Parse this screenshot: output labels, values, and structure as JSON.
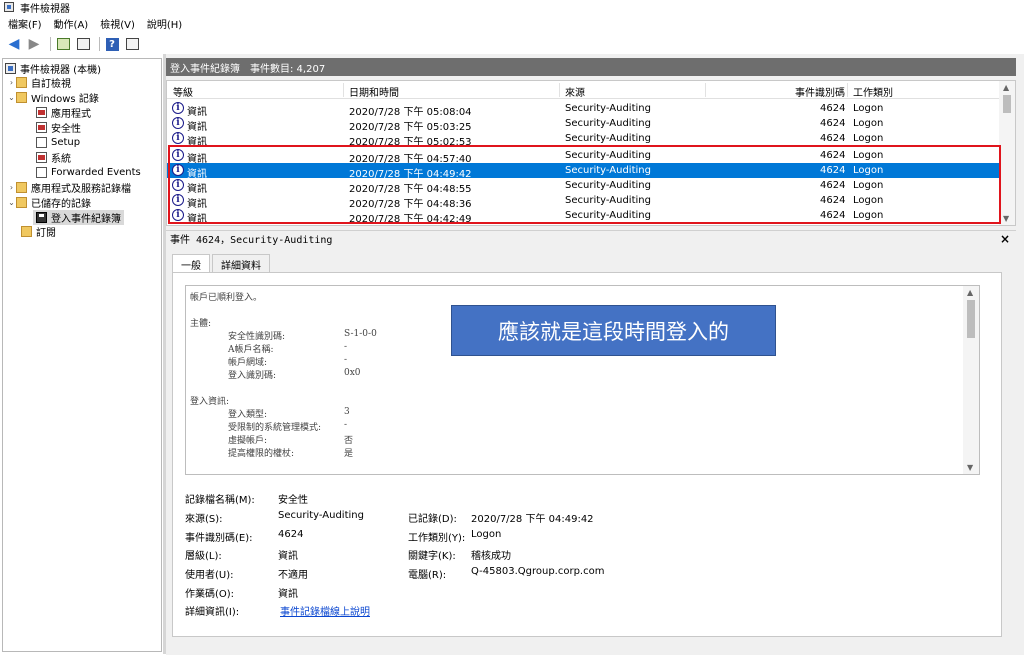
{
  "window": {
    "title": "事件檢視器"
  },
  "menu": [
    "檔案(F)",
    "動作(A)",
    "檢視(V)",
    "說明(H)"
  ],
  "tree": [
    {
      "label": "事件檢視器 (本機)",
      "icon": "root-icon"
    },
    {
      "label": "自訂檢視",
      "icon": "folder-icon"
    },
    {
      "label": "Windows 記錄",
      "icon": "folder-icon"
    },
    {
      "label": "應用程式",
      "icon": "log-icon"
    },
    {
      "label": "安全性",
      "icon": "log-icon"
    },
    {
      "label": "Setup",
      "icon": "log-icon"
    },
    {
      "label": "系統",
      "icon": "log-icon"
    },
    {
      "label": "Forwarded Events",
      "icon": "log-icon"
    },
    {
      "label": "應用程式及服務記錄檔",
      "icon": "folder-icon"
    },
    {
      "label": "已儲存的記錄",
      "icon": "folder-icon"
    },
    {
      "label": "登入事件紀錄簿",
      "icon": "saved-log-icon"
    },
    {
      "label": "訂閱",
      "icon": "subscription-icon"
    }
  ],
  "log_header": {
    "name": "登入事件紀錄簿",
    "count": "事件數目: 4,207"
  },
  "grid": {
    "columns": [
      "等級",
      "日期和時間",
      "來源",
      "事件識別碼",
      "工作類別"
    ],
    "rows": [
      {
        "level": "資訊",
        "datetime": "2020/7/28 下午 05:08:04",
        "source": "Security-Auditing",
        "id": "4624",
        "category": "Logon"
      },
      {
        "level": "資訊",
        "datetime": "2020/7/28 下午 05:03:25",
        "source": "Security-Auditing",
        "id": "4624",
        "category": "Logon"
      },
      {
        "level": "資訊",
        "datetime": "2020/7/28 下午 05:02:53",
        "source": "Security-Auditing",
        "id": "4624",
        "category": "Logon"
      },
      {
        "level": "資訊",
        "datetime": "2020/7/28 下午 04:57:40",
        "source": "Security-Auditing",
        "id": "4624",
        "category": "Logon"
      },
      {
        "level": "資訊",
        "datetime": "2020/7/28 下午 04:49:42",
        "source": "Security-Auditing",
        "id": "4624",
        "category": "Logon"
      },
      {
        "level": "資訊",
        "datetime": "2020/7/28 下午 04:48:55",
        "source": "Security-Auditing",
        "id": "4624",
        "category": "Logon"
      },
      {
        "level": "資訊",
        "datetime": "2020/7/28 下午 04:48:36",
        "source": "Security-Auditing",
        "id": "4624",
        "category": "Logon"
      },
      {
        "level": "資訊",
        "datetime": "2020/7/28 下午 04:42:49",
        "source": "Security-Auditing",
        "id": "4624",
        "category": "Logon"
      }
    ]
  },
  "detail": {
    "title": "事件 4624，Security-Auditing",
    "close": "×",
    "tabs": [
      "一般",
      "詳細資料"
    ],
    "description": [
      "帳戶已順利登入。",
      "主體:",
      "安全性識別碼:",
      "S-1-0-0",
      "A帳戶名稱:",
      "-",
      "帳戶網域:",
      "-",
      "登入識別碼:",
      "0x0",
      "登入資訊:",
      "登入類型:",
      "3",
      "受限制的系統管理模式:",
      "-",
      "虛擬帳戶:",
      "否",
      "提高權限的權杖:",
      "是"
    ],
    "properties": {
      "log_name_label": "記錄檔名稱(M):",
      "log_name": "安全性",
      "source_label": "來源(S):",
      "source": "Security-Auditing",
      "logged_label": "已記錄(D):",
      "logged": "2020/7/28 下午 04:49:42",
      "event_id_label": "事件識別碼(E):",
      "event_id": "4624",
      "task_label": "工作類別(Y):",
      "task": "Logon",
      "level_label": "層級(L):",
      "level": "資訊",
      "keywords_label": "關鍵字(K):",
      "keywords": "稽核成功",
      "user_label": "使用者(U):",
      "user": "不適用",
      "computer_label": "電腦(R):",
      "computer": "Q-45803.Qgroup.corp.com",
      "opcode_label": "作業碼(O):",
      "opcode": "資訊",
      "more_info_label": "詳細資訊(I):",
      "more_info": "事件記錄檔線上說明"
    }
  },
  "callout": "應該就是這段時間登入的",
  "colors": {
    "selection": "#0078d7",
    "highlight_box": "#e0141c",
    "callout": "#4472c4",
    "header_bar": "#6e6e6e"
  }
}
